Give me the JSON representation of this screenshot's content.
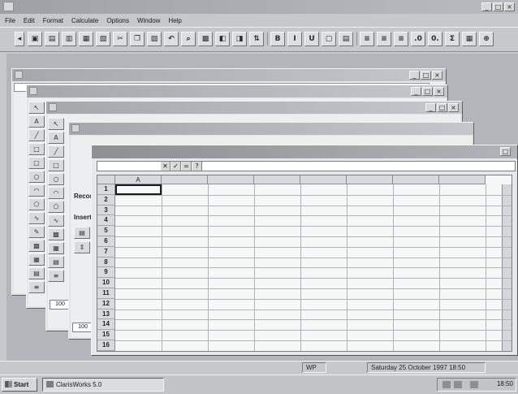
{
  "app": {
    "title": "",
    "window_buttons": [
      "_",
      "□",
      "×"
    ]
  },
  "menu": [
    "File",
    "Edit",
    "Format",
    "Calculate",
    "Options",
    "Window",
    "Help"
  ],
  "toolbar": {
    "buttons": [
      {
        "icon": "new-icon",
        "glyph": "▣"
      },
      {
        "icon": "open-icon",
        "glyph": "▤"
      },
      {
        "icon": "save-icon",
        "glyph": "▥"
      },
      {
        "icon": "print-icon",
        "glyph": "▦"
      },
      {
        "icon": "preview-icon",
        "glyph": "▧"
      },
      {
        "icon": "cut-icon",
        "glyph": "✂"
      },
      {
        "icon": "copy-icon",
        "glyph": "❐"
      },
      {
        "icon": "paste-icon",
        "glyph": "▨"
      },
      {
        "icon": "undo-icon",
        "glyph": "↶"
      },
      {
        "icon": "find-icon",
        "glyph": "⌕"
      },
      {
        "icon": "chart-icon",
        "glyph": "▩"
      },
      {
        "icon": "fill-icon",
        "glyph": "◧"
      },
      {
        "icon": "format-icon",
        "glyph": "◨"
      },
      {
        "icon": "sort-icon",
        "glyph": "⇅"
      },
      {
        "icon": "bold-icon",
        "glyph": "B"
      },
      {
        "icon": "italic-icon",
        "glyph": "I"
      },
      {
        "icon": "underline-icon",
        "glyph": "U"
      },
      {
        "icon": "border-icon",
        "glyph": "▢"
      },
      {
        "icon": "shade-icon",
        "glyph": "▤"
      },
      {
        "icon": "align-left-icon",
        "glyph": "≡"
      },
      {
        "icon": "align-center-icon",
        "glyph": "≡"
      },
      {
        "icon": "align-right-icon",
        "glyph": "≡"
      },
      {
        "icon": "decimal-dec-icon",
        "glyph": ".0"
      },
      {
        "icon": "decimal-inc-icon",
        "glyph": "0."
      },
      {
        "icon": "sum-icon",
        "glyph": "Σ"
      },
      {
        "icon": "chart-wizard-icon",
        "glyph": "▦"
      },
      {
        "icon": "zoom-icon",
        "glyph": "⊕"
      }
    ]
  },
  "windows": {
    "record_label": "Record",
    "insert_label": "Insert",
    "zoom_values": [
      "100",
      "100",
      "100"
    ]
  },
  "sheet": {
    "columns": [
      "A",
      "",
      "",
      "",
      "",
      "",
      "",
      ""
    ],
    "rows": [
      "1",
      "2",
      "3",
      "4",
      "5",
      "6",
      "7",
      "8",
      "9",
      "10",
      "11",
      "12",
      "13",
      "14",
      "15",
      "16"
    ],
    "edit_buttons": [
      "✕",
      "✓",
      "=",
      "?"
    ]
  },
  "status": {
    "mode": "WP",
    "datetime": "Saturday 25 October 1997 18:50"
  },
  "taskbar": {
    "start_label": "Start",
    "task_label": "ClarisWorks 5.0",
    "clock": "18:50"
  },
  "colors": {
    "desktop": "#c6c9cc",
    "title_bar": "#9ea2a6",
    "workspace": "#b2b6ba"
  }
}
